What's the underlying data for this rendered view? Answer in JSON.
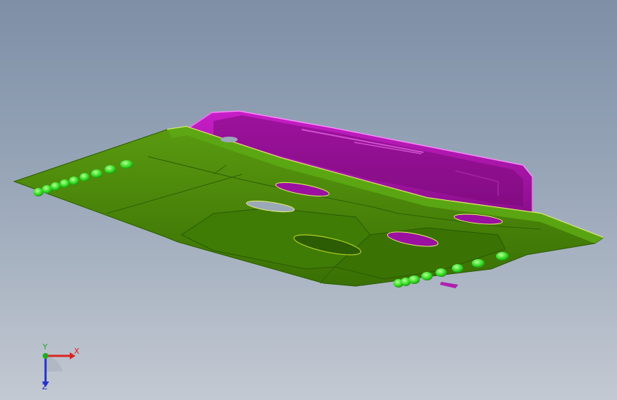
{
  "viewport": {
    "background_top": "#7e8fa6",
    "background_bottom": "#c3c9d2"
  },
  "model": {
    "bracket_color": "#cc22cc",
    "plate_color": "#4a8a08",
    "plate_edge_highlight": "#e8f070",
    "fastener_color": "#33dd33"
  },
  "triad": {
    "x_label": "X",
    "y_label": "Y",
    "z_label": "Z",
    "x_color": "#dd2222",
    "y_color": "#22aa22",
    "z_color": "#2233cc"
  }
}
